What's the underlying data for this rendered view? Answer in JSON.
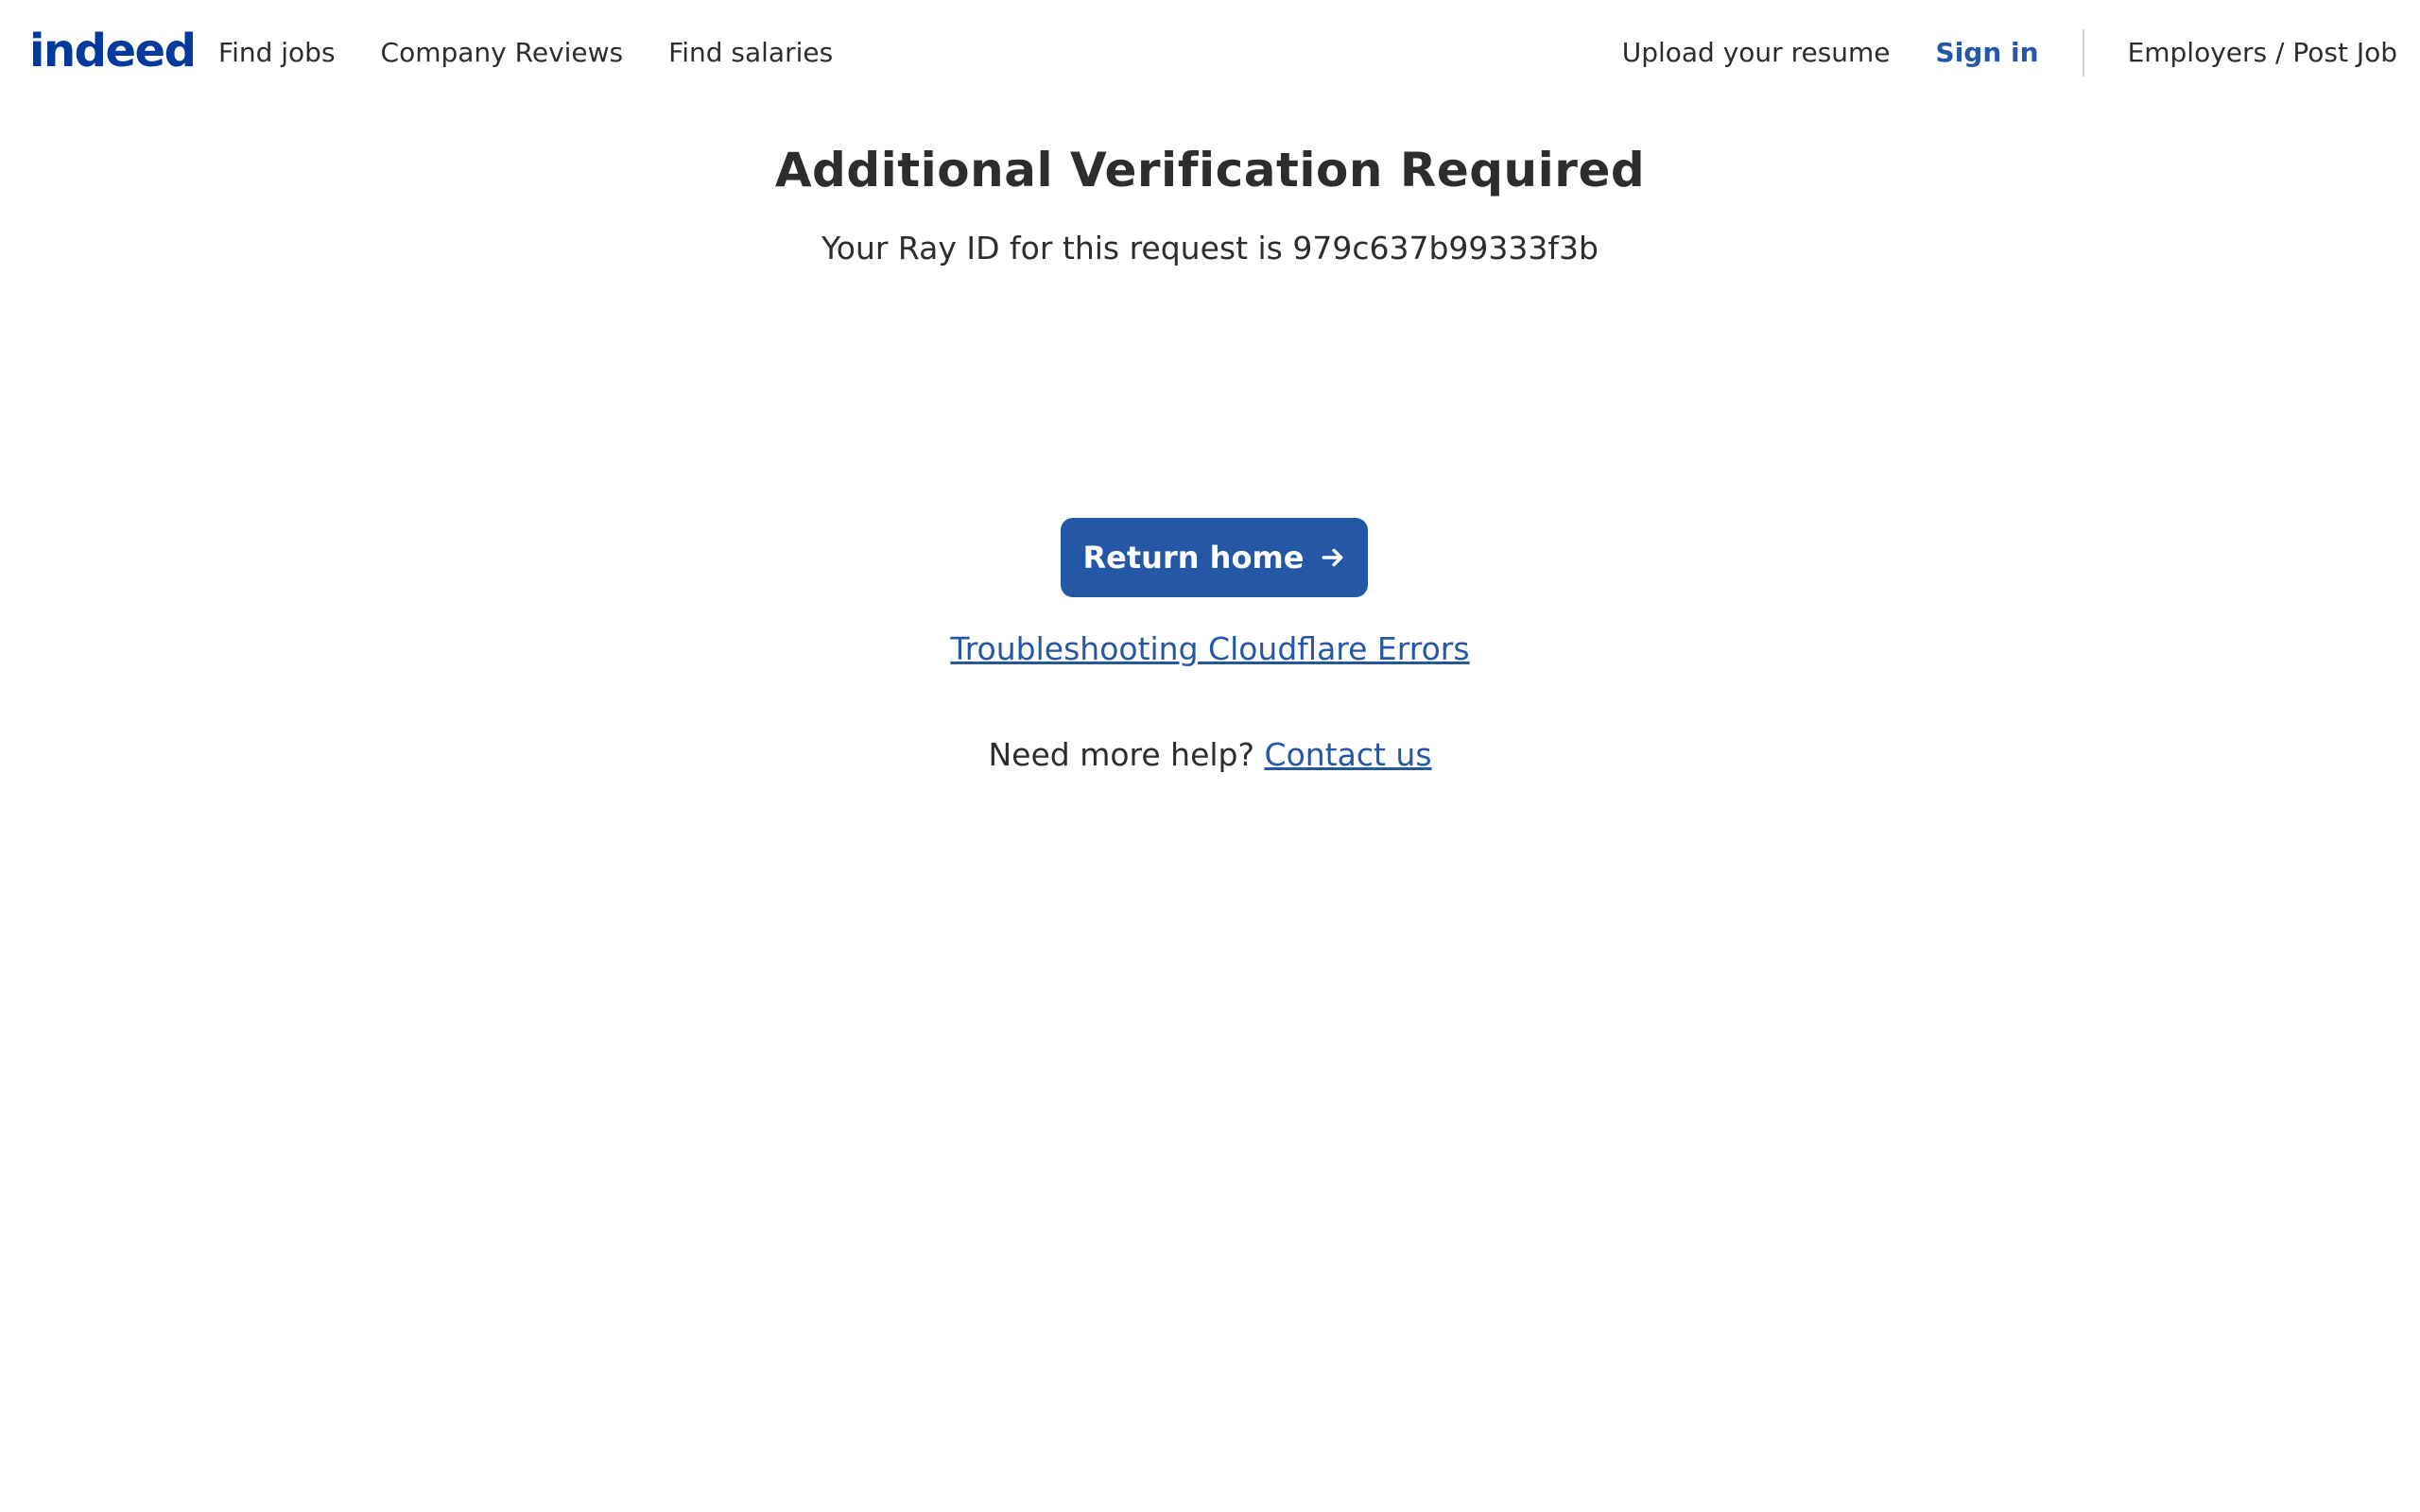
{
  "header": {
    "logo_text": "indeed",
    "nav_left": [
      {
        "label": "Find jobs"
      },
      {
        "label": "Company Reviews"
      },
      {
        "label": "Find salaries"
      }
    ],
    "upload_label": "Upload your resume",
    "signin_label": "Sign in",
    "employers_label": "Employers / Post Job"
  },
  "main": {
    "title": "Additional Verification Required",
    "ray_id_text": "Your Ray ID for this request is 979c637b99333f3b",
    "return_button_label": "Return home",
    "troubleshooting_link": "Troubleshooting Cloudflare Errors",
    "help_text": "Need more help?",
    "contact_link": "Contact us"
  },
  "colors": {
    "brand": "#003a9b",
    "accent": "#2557a7",
    "text": "#2d2d2d",
    "divider": "#d4d2d0"
  },
  "icons": {
    "button_icon": "arrow-right-icon"
  }
}
